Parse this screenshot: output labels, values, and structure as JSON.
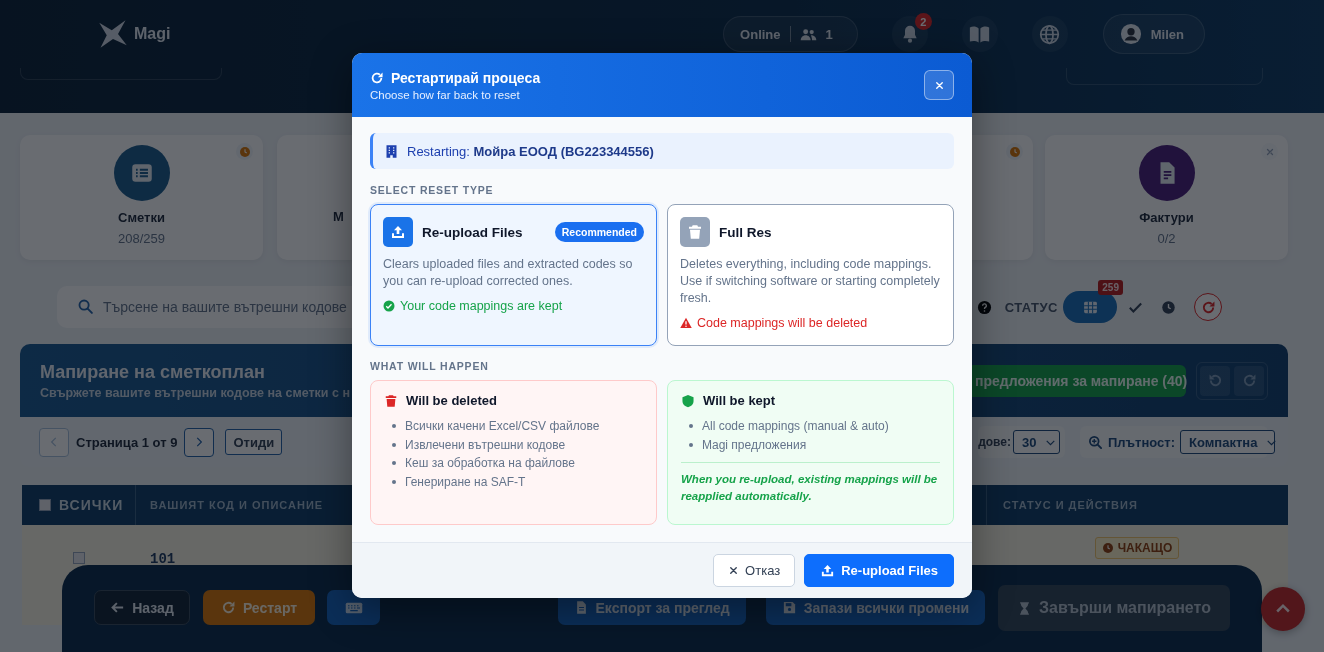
{
  "header": {
    "logo": "Magi",
    "online": {
      "label": "Online",
      "count": "1"
    },
    "notification_badge": "2",
    "user": "Milen"
  },
  "cards": [
    {
      "kind": "pending",
      "title": "Сметки",
      "value": "208/259"
    },
    {
      "kind": "plain",
      "title": "М"
    },
    {
      "kind": "pending"
    },
    {
      "kind": "closable",
      "title": "Фактури",
      "value": "0/2"
    }
  ],
  "search": {
    "placeholder": "Търсене на вашите вътрешни кодове"
  },
  "status_filter": {
    "label": "СТАТУС",
    "options": [
      {
        "kind": "all",
        "badge": "259",
        "selected": true
      },
      {
        "kind": "done",
        "selected": false
      },
      {
        "kind": "pending",
        "selected": false
      },
      {
        "kind": "restart",
        "selected": false
      }
    ]
  },
  "panel": {
    "title": "Мапиране на сметкоплан",
    "subtitle": "Свържете вашите вътрешни кодове на сметки с н",
    "suggest_button": "предложения за мапиране (40)"
  },
  "pagination": {
    "label": "Страница 1 от 9",
    "go_button": "Отиди",
    "rows_label": "дове:",
    "rows_value": "30",
    "density_label": "Плътност:",
    "density_value": "Компактна"
  },
  "table": {
    "select_all_checked": false,
    "columns": [
      "ВСИЧКИ",
      "ВАШИЯТ КОД И ОПИСАНИЕ",
      "СТАТУС И ДЕЙСТВИЯ"
    ],
    "rows": [
      {
        "checked": false,
        "code": "101",
        "status": "ЧАКАЩО"
      }
    ]
  },
  "actions": [
    {
      "kind": "back",
      "label": "Назад",
      "disabled": false
    },
    {
      "kind": "restart",
      "label": "Рестарт",
      "disabled": false
    },
    {
      "kind": "keyboard",
      "disabled": false
    },
    {
      "kind": "export",
      "label": "Експорт за преглед",
      "disabled": false
    },
    {
      "kind": "save",
      "label": "Запази всички промени",
      "disabled": false
    },
    {
      "kind": "finish",
      "label": "Завърши мапирането",
      "disabled": true
    }
  ],
  "modal": {
    "title": "Рестартирай процеса",
    "subtitle": "Choose how far back to reset",
    "info": "Restarting: **Мойра ЕООД (BG223344556)**",
    "reset_section": "SELECT RESET TYPE",
    "options": [
      {
        "kind": "reupload",
        "title": "Re-upload Files",
        "badge": "Recommended",
        "description": "Clears uploaded files and extracted codes so you can re-upload corrected ones.",
        "note": {
          "kind": "ok",
          "text": "Your code mappings are kept"
        },
        "selected": true
      },
      {
        "kind": "full",
        "title": "Full Res",
        "description": "Deletes everything, including code mappings. Use if switching software or starting completely fresh.",
        "note": {
          "kind": "warning",
          "text": "Code mappings will be deleted"
        },
        "selected": false
      }
    ],
    "outcome_section": "WHAT WILL HAPPEN",
    "outcomes": [
      {
        "kind": "deleted",
        "title": "Will be deleted",
        "items": [
          "Всички качени Excel/CSV файлове",
          "Извлечени вътрешни кодове",
          "Кеш за обработка на файлове",
          "Генериране на SAF-T"
        ]
      },
      {
        "kind": "kept",
        "title": "Will be kept",
        "items": [
          "All code mappings (manual & auto)",
          "Magi предложения"
        ],
        "note": "When you re-upload, existing mappings will be reapplied automatically."
      }
    ],
    "buttons": [
      {
        "kind": "cancel",
        "label": "Отказ"
      },
      {
        "kind": "primary",
        "label": "Re-upload Files"
      }
    ]
  }
}
